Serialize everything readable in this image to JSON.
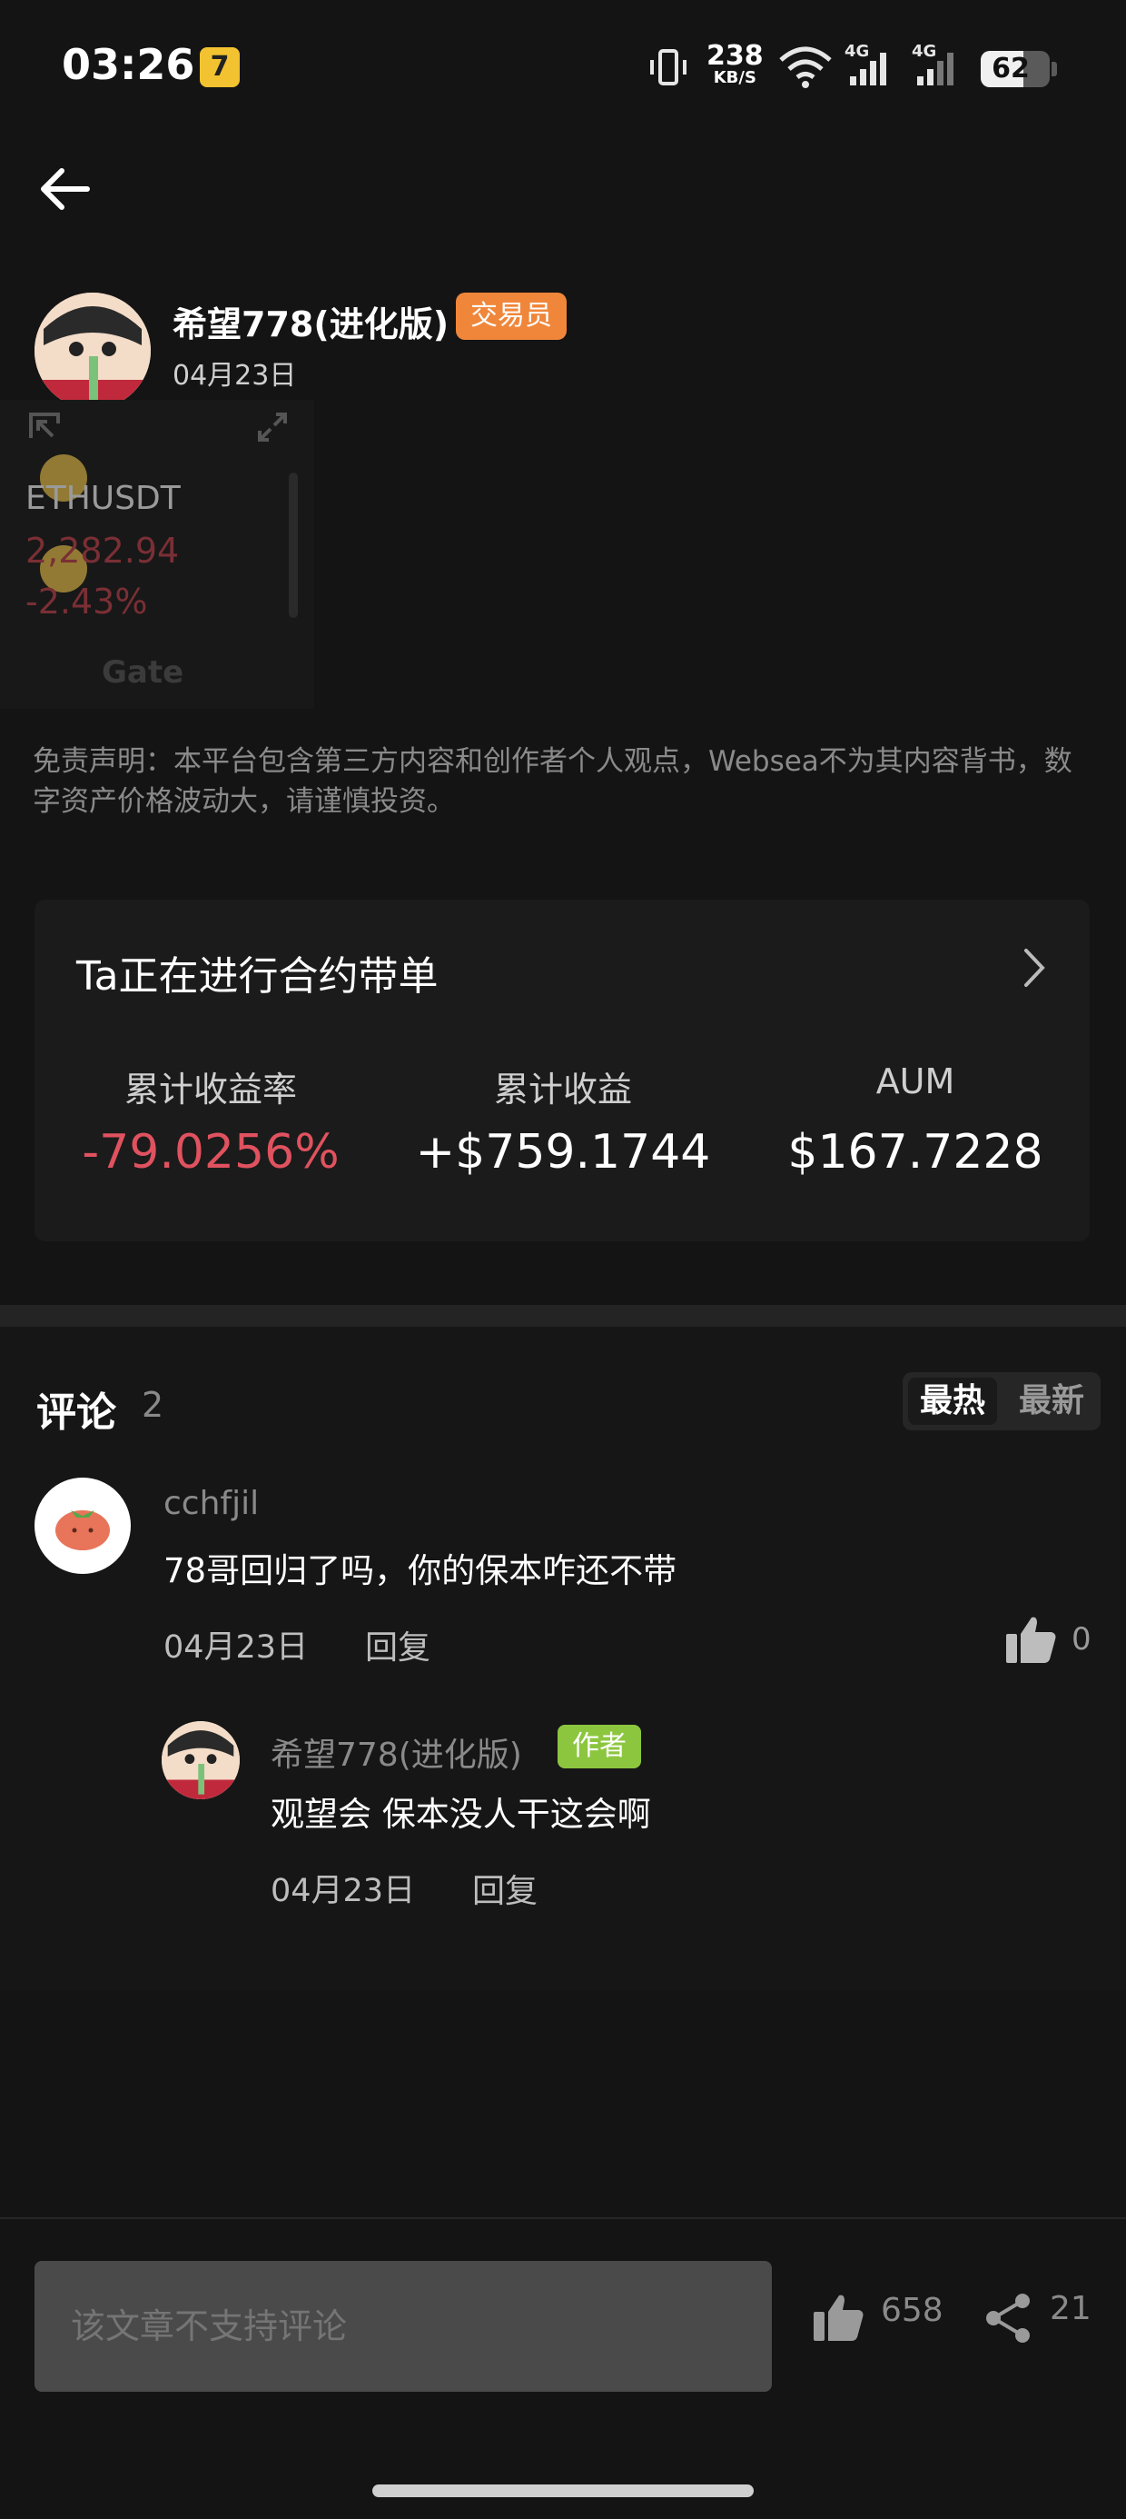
{
  "status_bar": {
    "time": "03:26",
    "net_speed": "238",
    "net_speed_unit": "KB/S",
    "signal_1": "4G",
    "signal_2": "4G",
    "battery": "62",
    "battery_level": 0.62
  },
  "post": {
    "author": "希望778(进化版)",
    "author_badge": "交易员",
    "date": "04月23日",
    "widget": {
      "symbol": "ETHUSDT",
      "price": "2,282.94",
      "change": "-2.43%",
      "brand": "Gate"
    },
    "disclaimer": "免责声明：本平台包含第三方内容和创作者个人观点，Websea不为其内容背书，数字资产价格波动大，请谨慎投资。"
  },
  "copy_trade": {
    "title": "Ta正在进行合约带单",
    "stats": [
      {
        "label": "累计收益率",
        "value": "-79.0256%",
        "color": "#e0525f"
      },
      {
        "label": "累计收益",
        "value": "+$759.1744",
        "color": "#ffffff"
      },
      {
        "label": "AUM",
        "value": "$167.7228",
        "color": "#ffffff"
      }
    ]
  },
  "comments": {
    "title": "评论",
    "count": "2",
    "sort_hot": "最热",
    "sort_new": "最新",
    "items": [
      {
        "user": "cchfjil",
        "text": "78哥回归了吗，你的保本咋还不带",
        "date": "04月23日",
        "reply_label": "回复",
        "likes": "0",
        "replies": [
          {
            "user": "希望778(进化版)",
            "badge": "作者",
            "text": "观望会 保本没人干这会啊",
            "date": "04月23日",
            "reply_label": "回复"
          }
        ]
      }
    ]
  },
  "bottom_bar": {
    "input_placeholder": "该文章不支持评论",
    "likes": "658",
    "shares": "21"
  },
  "colors": {
    "background": "#141414",
    "trader_badge": "#f0863a",
    "author_badge": "#8cc63f",
    "negative": "#e0525f"
  },
  "icons": [
    "back-arrow-icon",
    "chevron-right-icon",
    "thumb-up-icon",
    "share-icon"
  ]
}
